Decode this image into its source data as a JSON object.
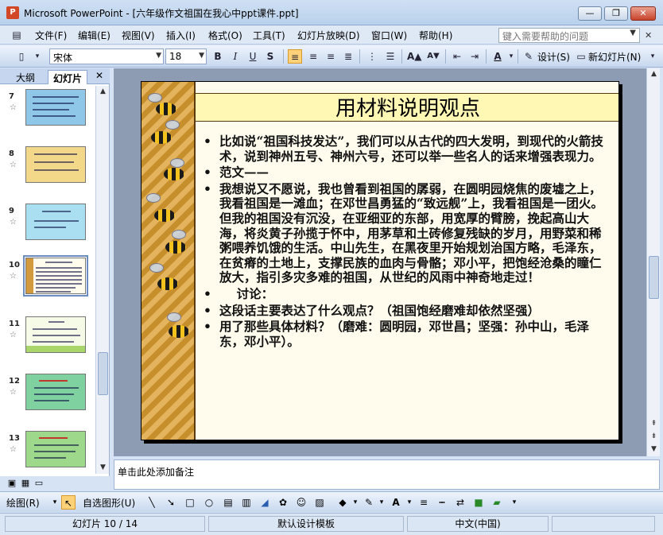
{
  "window": {
    "title": "Microsoft PowerPoint - [六年级作文祖国在我心中ppt课件.ppt]",
    "app_icon_letter": "P",
    "minimize_glyph": "—",
    "restore_glyph": "❐",
    "close_glyph": "✕"
  },
  "menu": {
    "items": [
      "文件(F)",
      "编辑(E)",
      "视图(V)",
      "插入(I)",
      "格式(O)",
      "工具(T)",
      "幻灯片放映(D)",
      "窗口(W)",
      "帮助(H)"
    ],
    "help_placeholder": "键入需要帮助的问题"
  },
  "toolbar": {
    "font_name": "宋体",
    "font_size": "18",
    "bold": "B",
    "italic": "I",
    "underline": "U",
    "shadow": "S",
    "design_label": "设计(S)",
    "new_slide_label": "新幻灯片(N)"
  },
  "left_pane": {
    "tabs": [
      "大纲",
      "幻灯片"
    ],
    "active_tab": "幻灯片",
    "close_glyph": "✕",
    "thumbnails": [
      {
        "number": "7",
        "bg": "#8fc7e8"
      },
      {
        "number": "8",
        "bg": "#f3d88a"
      },
      {
        "number": "9",
        "bg": "#a9dff0"
      },
      {
        "number": "10",
        "bg": "#e7b75c",
        "selected": true
      },
      {
        "number": "11",
        "bg": "#d9efb3"
      },
      {
        "number": "12",
        "bg": "#7fd1a0"
      },
      {
        "number": "13",
        "bg": "#9ed88a"
      }
    ]
  },
  "slide": {
    "title": "用材料说明观点",
    "bullets": [
      "比如说“祖国科技发达”，我们可以从古代的四大发明，到现代的火箭技术，说到神州五号、神州六号，还可以举一些名人的话来增强表现力。",
      "范文——",
      "我想说又不愿说，我也曾看到祖国的孱弱，在圆明园烧焦的废墟之上，我看祖国是一滩血；在邓世昌勇猛的“致远舰”上，我看祖国是一团火。但我的祖国没有沉没，在亚细亚的东部，用宽厚的臂膀，挽起高山大海，将炎黄子孙揽于怀中，用茅草和土砖修复残缺的岁月，用野菜和稀粥喂养饥饿的生活。中山先生，在黑夜里开始规划治国方略，毛泽东，在贫瘠的土地上，支撑民族的血肉与骨骼；邓小平，把饱经沧桑的瞳仁放大，指引多灾多难的祖国，从世纪的风雨中神奇地走过！",
      "    讨论：",
      "这段话主要表达了什么观点？（祖国饱经磨难却依然坚强）",
      "用了那些具体材料？（磨难：圆明园，邓世昌；坚强：孙中山，毛泽东，邓小平）。"
    ]
  },
  "notes": {
    "placeholder": "单击此处添加备注"
  },
  "drawing_toolbar": {
    "draw_label": "绘图(R)",
    "autoshape_label": "自选图形(U)"
  },
  "statusbar": {
    "slide_position": "幻灯片 10 / 14",
    "template": "默认设计模板",
    "language": "中文(中国)"
  },
  "colors": {
    "accent": "#ffd27a",
    "titlebar": "#b9d1ec",
    "slide_bg": "#fffcee"
  }
}
